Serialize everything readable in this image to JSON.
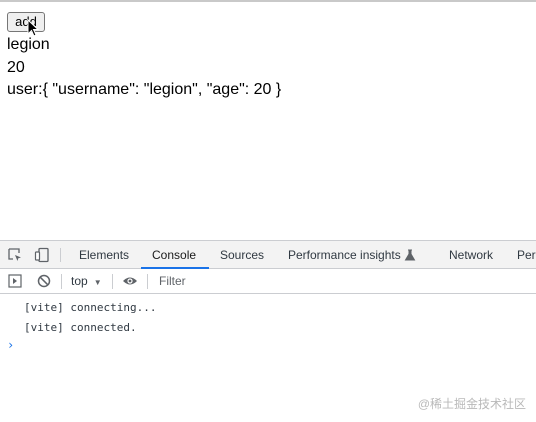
{
  "page": {
    "button_label": "add",
    "name": "legion",
    "age": "20",
    "user_line": "user:{ \"username\": \"legion\", \"age\": 20 }"
  },
  "devtools": {
    "tabs": [
      {
        "label": "Elements"
      },
      {
        "label": "Console",
        "active": true
      },
      {
        "label": "Sources"
      },
      {
        "label": "Performance insights"
      },
      {
        "label": "Network"
      },
      {
        "label": "Per"
      }
    ],
    "toolbar": {
      "context": "top",
      "filter_placeholder": "Filter"
    },
    "console_lines": [
      "[vite] connecting...",
      "[vite] connected."
    ],
    "prompt": "›"
  },
  "watermark": "@稀土掘金技术社区",
  "colors": {
    "accent": "#1a73e8",
    "tab_bar_bg": "#f3f3f3",
    "border": "#cbcdd1"
  }
}
